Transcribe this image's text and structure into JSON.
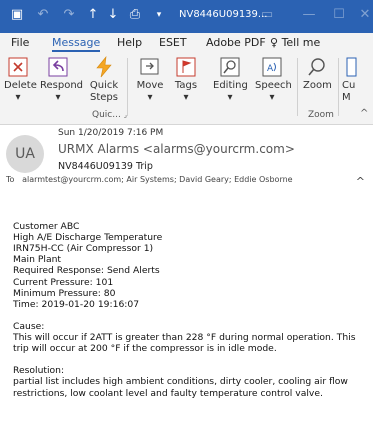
{
  "titlebar": {
    "title": "NV8446U09139..."
  },
  "tabs": [
    "File",
    "Message",
    "Help",
    "ESET",
    "Adobe PDF",
    "Tell me"
  ],
  "ribbon": {
    "buttons": [
      "Delete",
      "Respond",
      "Quick\nSteps",
      "Move",
      "Tags",
      "Editing",
      "Speech",
      "Zoom",
      "Cu\nM"
    ],
    "group_quick": "Quic...",
    "group_zoom": "Zoom"
  },
  "header": {
    "avatar_initials": "UA",
    "date": "Sun 1/20/2019 7:16 PM",
    "from": "URMX Alarms <alarms@yourcrm.com>",
    "subject": "NV8446U09139 Trip",
    "to_label": "To",
    "to": "alarmtest@yourcrm.com; Air Systems; David Geary; Eddie Osborne"
  },
  "body": {
    "l1": "Customer ABC",
    "l2": "High A/E Discharge Temperature",
    "l3": "IRN75H-CC (Air Compressor 1)",
    "l4": "Main Plant",
    "l5": "Required Response: Send Alerts",
    "l6": "Current Pressure: 101",
    "l7": "Minimum Pressure: 80",
    "l8": "Time: 2019-01-20 19:16:07",
    "cause_label": "Cause:",
    "cause_text": "This will occur if 2ATT is greater than 228 °F during normal operation. This trip will occur at 200 °F if the compressor is in idle mode.",
    "resolution_label": "Resolution:",
    "resolution_text": "partial list includes high ambient conditions, dirty cooler, cooling air flow restrictions, low coolant level and faulty temperature control valve."
  }
}
